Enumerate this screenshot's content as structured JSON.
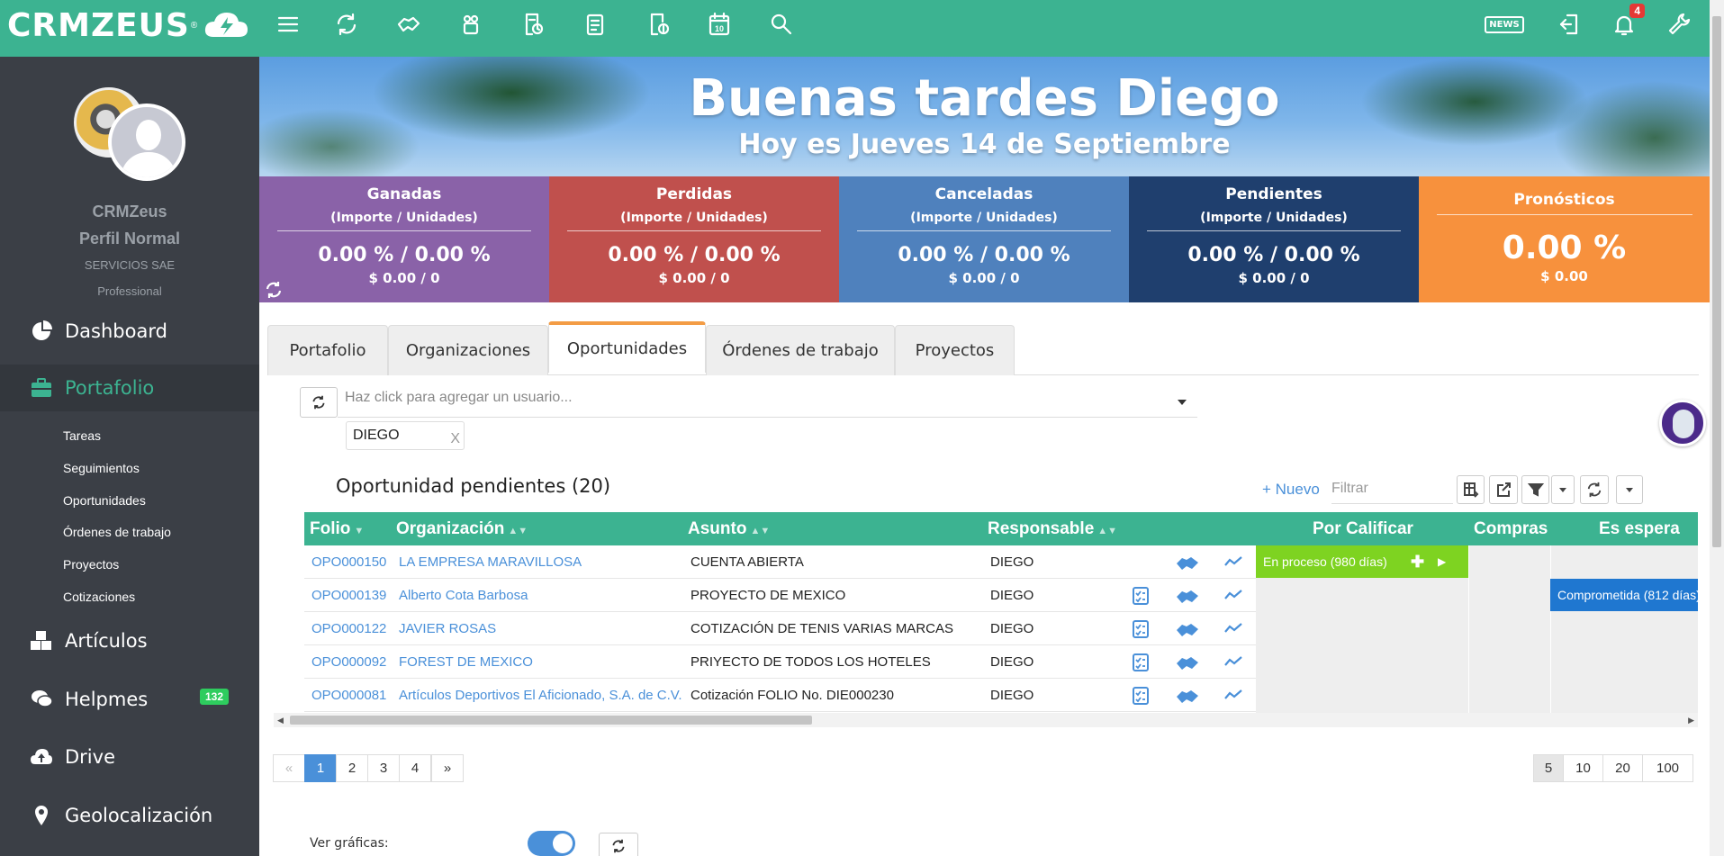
{
  "header": {
    "logo_text": "CRMZEUS",
    "logo_reg": "®",
    "news_label": "NEWS",
    "notification_count": "4",
    "colors": {
      "bar": "#3cb391"
    }
  },
  "sidebar": {
    "user_name": "CRMZeus",
    "profile": "Perfil Normal",
    "company": "SERVICIOS SAE",
    "plan": "Professional",
    "items": [
      {
        "label": "Dashboard",
        "icon": "pie-chart-icon"
      },
      {
        "label": "Portafolio",
        "icon": "briefcase-icon"
      },
      {
        "label": "Artículos",
        "icon": "boxes-icon"
      },
      {
        "label": "Helpmes",
        "icon": "chat-icon",
        "badge": "132"
      },
      {
        "label": "Drive",
        "icon": "cloud-upload-icon"
      },
      {
        "label": "Geolocalización",
        "icon": "map-pin-icon"
      }
    ],
    "sub_items": [
      "Tareas",
      "Seguimientos",
      "Oportunidades",
      "Órdenes de trabajo",
      "Proyectos",
      "Cotizaciones"
    ]
  },
  "banner": {
    "greeting": "Buenas tardes Diego",
    "date": "Hoy es Jueves 14 de Septiembre"
  },
  "stats": [
    {
      "title": "Ganadas",
      "sub": "(Importe / Unidades)",
      "pct": "0.00 % / 0.00 %",
      "amount": "$ 0.00 / 0",
      "color": "#8a62a8"
    },
    {
      "title": "Perdidas",
      "sub": "(Importe / Unidades)",
      "pct": "0.00 % / 0.00 %",
      "amount": "$ 0.00 / 0",
      "color": "#c0504d"
    },
    {
      "title": "Canceladas",
      "sub": "(Importe / Unidades)",
      "pct": "0.00 % / 0.00 %",
      "amount": "$ 0.00 / 0",
      "color": "#4f81bd"
    },
    {
      "title": "Pendientes",
      "sub": "(Importe / Unidades)",
      "pct": "0.00 % / 0.00 %",
      "amount": "$ 0.00 / 0",
      "color": "#1f3f6e"
    },
    {
      "title": "Pronósticos",
      "pct": "0.00 %",
      "amount": "$ 0.00",
      "color": "#f7913d"
    }
  ],
  "tabs": [
    "Portafolio",
    "Organizaciones",
    "Oportunidades",
    "Órdenes de trabajo",
    "Proyectos"
  ],
  "filter": {
    "placeholder": "Haz click para agregar un usuario...",
    "chip": "DIEGO",
    "chip_remove": "X"
  },
  "list": {
    "title": "Oportunidad pendientes (20)",
    "new_label": "+ Nuevo",
    "filter_placeholder": "Filtrar",
    "columns": [
      "Folio",
      "Organización",
      "Asunto",
      "Responsable",
      "Por Calificar",
      "Compras",
      "Es espera cl"
    ],
    "rows": [
      {
        "folio": "OPO000150",
        "org": "LA EMPRESA MARAVILLOSA",
        "asunto": "CUENTA ABIERTA",
        "resp": "DIEGO"
      },
      {
        "folio": "OPO000139",
        "org": "Alberto Cota Barbosa",
        "asunto": "PROYECTO DE MEXICO",
        "resp": "DIEGO"
      },
      {
        "folio": "OPO000122",
        "org": "JAVIER ROSAS",
        "asunto": "COTIZACIÓN DE TENIS VARIAS MARCAS",
        "resp": "DIEGO"
      },
      {
        "folio": "OPO000092",
        "org": "FOREST DE MEXICO",
        "asunto": "PRIYECTO DE TODOS LOS HOTELES",
        "resp": "DIEGO"
      },
      {
        "folio": "OPO000081",
        "org": "Artículos Deportivos El Aficionado, S.A. de C.V.",
        "asunto": "Cotización FOLIO No. DIE000230",
        "resp": "DIEGO"
      }
    ],
    "stage_in_process": "En proceso (980 días)",
    "stage_committed": "Comprometida (812 días)"
  },
  "pagination": {
    "prev": "«",
    "pages": [
      "1",
      "2",
      "3",
      "4"
    ],
    "next": "»",
    "sizes": [
      "5",
      "10",
      "20",
      "100"
    ]
  },
  "charts_toggle": {
    "label": "Ver gráficas:"
  }
}
